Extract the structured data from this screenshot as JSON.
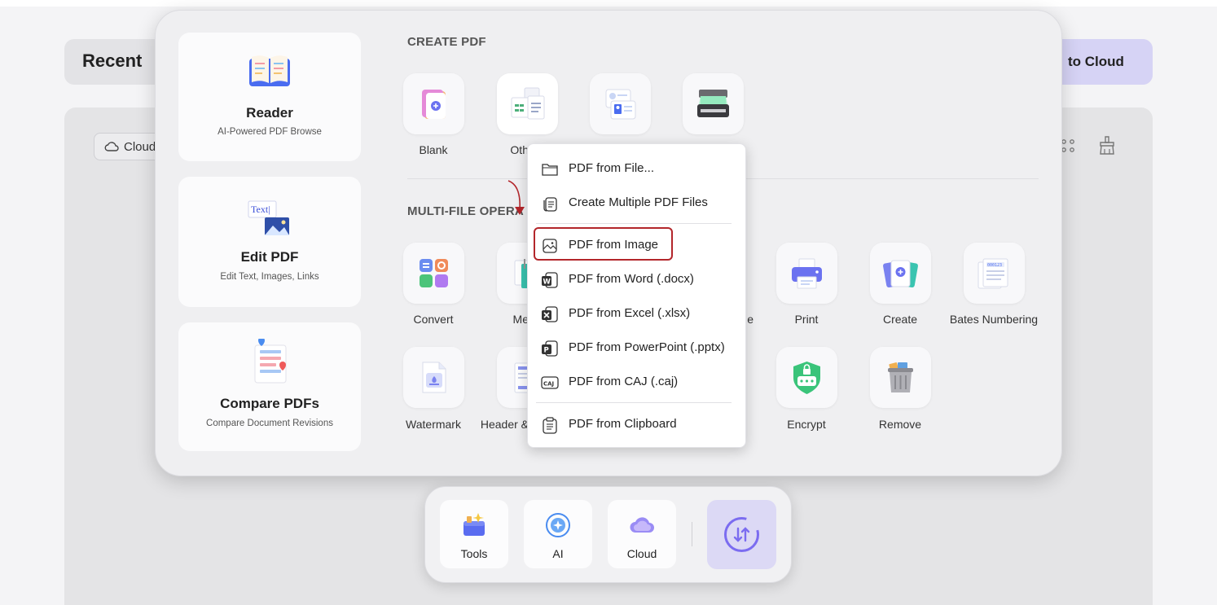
{
  "background": {
    "recent_title": "Recent",
    "cloud_button_label": "to Cloud",
    "cloud_filter_label": "Cloud"
  },
  "left_cards": [
    {
      "title": "Reader",
      "subtitle": "AI-Powered PDF Browse"
    },
    {
      "title": "Edit PDF",
      "subtitle": "Edit Text, Images, Links"
    },
    {
      "title": "Compare PDFs",
      "subtitle": "Compare Document Revisions"
    }
  ],
  "create_pdf": {
    "title": "CREATE PDF",
    "tools": [
      {
        "label": "Blank",
        "icon": "blank-page-icon"
      },
      {
        "label": "Oth",
        "icon": "other-documents-icon"
      },
      {
        "label": "",
        "icon": "scan-id-icon"
      },
      {
        "label": "",
        "icon": "scanner-icon"
      }
    ]
  },
  "multi_file": {
    "title": "MULTI-FILE OPERA",
    "row1": [
      {
        "label": "Convert",
        "icon": "convert-icon"
      },
      {
        "label": "Me",
        "icon": "merge-icon"
      },
      {
        "label": "e",
        "icon": "compress-icon"
      },
      {
        "label": "Print",
        "icon": "printer-icon"
      },
      {
        "label": "Create",
        "icon": "create-icon"
      },
      {
        "label": "Bates Numbering",
        "icon": "bates-numbering-icon"
      }
    ],
    "row2": [
      {
        "label": "Watermark",
        "icon": "watermark-icon"
      },
      {
        "label": "Header &",
        "icon": "header-footer-icon"
      },
      {
        "label": "Encrypt",
        "icon": "encrypt-shield-icon"
      },
      {
        "label": "Remove",
        "icon": "trash-can-icon"
      }
    ]
  },
  "dropdown": {
    "items": [
      {
        "label": "PDF from File...",
        "icon": "folder-icon"
      },
      {
        "label": "Create Multiple PDF Files",
        "icon": "multiple-files-icon"
      },
      {
        "label": "PDF from Image",
        "icon": "image-icon"
      },
      {
        "label": "PDF from Word (.docx)",
        "icon": "word-icon"
      },
      {
        "label": "PDF from Excel (.xlsx)",
        "icon": "excel-icon"
      },
      {
        "label": "PDF from PowerPoint (.pptx)",
        "icon": "powerpoint-icon"
      },
      {
        "label": "PDF from CAJ (.caj)",
        "icon": "caj-icon"
      },
      {
        "label": "PDF from Clipboard",
        "icon": "clipboard-icon"
      }
    ],
    "highlighted": "PDF from Image"
  },
  "dock": {
    "items": [
      {
        "label": "Tools",
        "icon": "toolbox-icon"
      },
      {
        "label": "AI",
        "icon": "ai-sparkle-icon"
      },
      {
        "label": "Cloud",
        "icon": "cloud-icon"
      }
    ]
  },
  "colors": {
    "accent": "#7b6cf0",
    "highlight_border": "#b3262b",
    "panel_bg": "#efeff1"
  }
}
